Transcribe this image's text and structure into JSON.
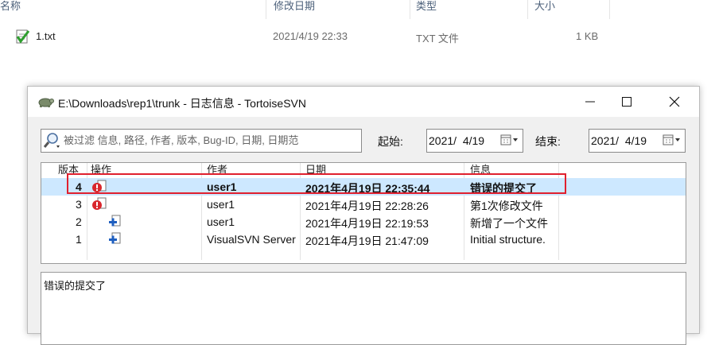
{
  "explorer": {
    "columns": [
      "名称",
      "修改日期",
      "类型",
      "大小"
    ],
    "file": {
      "name": "1.txt",
      "modified": "2021/4/19 22:33",
      "type": "TXT 文件",
      "size": "1 KB"
    }
  },
  "dialog": {
    "title": "E:\\Downloads\\rep1\\trunk - 日志信息 - TortoiseSVN",
    "filter_placeholder": "被过滤 信息, 路径, 作者, 版本, Bug-ID, 日期, 日期范",
    "start_label": "起始:",
    "start_date": "2021/  4/19",
    "end_label": "结束:",
    "end_date": "2021/  4/19",
    "columns": [
      "版本",
      "操作",
      "作者",
      "日期",
      "信息"
    ],
    "rows": [
      {
        "rev": "4",
        "author": "user1",
        "date": "2021年4月19日 22:35:44",
        "message": "错误的提交了",
        "action_icon": "error-modified-icon",
        "selected": true
      },
      {
        "rev": "3",
        "author": "user1",
        "date": "2021年4月19日 22:28:26",
        "message": "第1次修改文件",
        "action_icon": "error-modified-icon",
        "selected": false
      },
      {
        "rev": "2",
        "author": "user1",
        "date": "2021年4月19日 22:19:53",
        "message": "新增了一个文件",
        "action_icon": "added-icon",
        "selected": false
      },
      {
        "rev": "1",
        "author": "VisualSVN Server",
        "date": "2021年4月19日 21:47:09",
        "message": "Initial structure.",
        "action_icon": "added-icon",
        "selected": false
      }
    ],
    "detail_message": "错误的提交了"
  },
  "colors": {
    "selection": "#cde8ff",
    "highlight_box": "#e0202e"
  }
}
